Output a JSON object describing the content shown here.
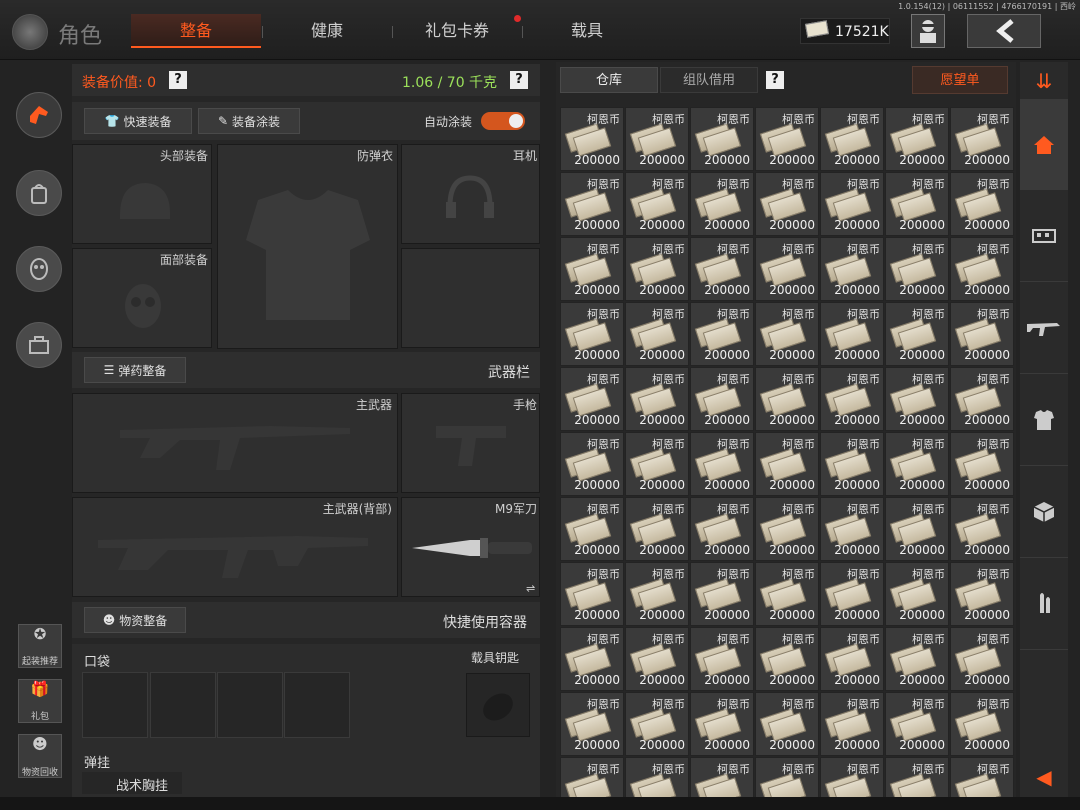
{
  "version": "1.0.154(12) | 06111552 | 4766170191 | 西岭",
  "header": {
    "title": "角色",
    "tabs": [
      {
        "label": "整备",
        "active": true
      },
      {
        "label": "健康",
        "active": false
      },
      {
        "label": "礼包卡券",
        "active": false,
        "has_notification": true
      },
      {
        "label": "载具",
        "active": false
      }
    ],
    "currency_amount": "17521K",
    "back_icon": "chevron-left-icon"
  },
  "left_nav": {
    "icons": [
      "character-icon",
      "backpack-icon",
      "mask-icon",
      "toolbox-icon"
    ],
    "bottom_buttons": [
      {
        "label": "起装推荐",
        "icon": "recommend-icon"
      },
      {
        "label": "礼包",
        "icon": "gift-icon"
      },
      {
        "label": "物资回收",
        "icon": "recycle-icon"
      }
    ]
  },
  "equipment": {
    "value_label": "装备价值: 0",
    "weight_label": "1.06 / 70 千克",
    "quick_equip": "快速装备",
    "paint_label": "装备涂装",
    "auto_paint_label": "自动涂装",
    "auto_paint_on": true,
    "slots": {
      "head": "头部装备",
      "armor": "防弹衣",
      "headset": "耳机",
      "face": "面部装备"
    },
    "ammo_button": "弹药整备",
    "weapons_title": "武器栏",
    "primary": "主武器",
    "pistol": "手枪",
    "primary_back": "主武器(背部)",
    "knife": "M9军刀",
    "supply_button": "物资整备",
    "quick_container_title": "快捷使用容器",
    "pocket_label": "口袋",
    "vehicle_key_label": "载具钥匙",
    "hang_label": "弹挂",
    "rig_label": "战术胸挂"
  },
  "storage": {
    "tabs": [
      {
        "label": "仓库",
        "active": true
      },
      {
        "label": "组队借用",
        "active": false
      }
    ],
    "wishlist_label": "愿望单",
    "item_name": "柯恩币",
    "item_amount": "200000",
    "columns": 7,
    "rows": 11
  },
  "right_nav": {
    "icons": [
      "sort-icon",
      "home-icon",
      "vehicle-icon",
      "rifle-icon",
      "armor-icon",
      "package-icon",
      "ammo-icon",
      "collapse-arrow-icon"
    ]
  },
  "colors": {
    "accent": "#ff5a1f",
    "weight": "#9be05a"
  }
}
